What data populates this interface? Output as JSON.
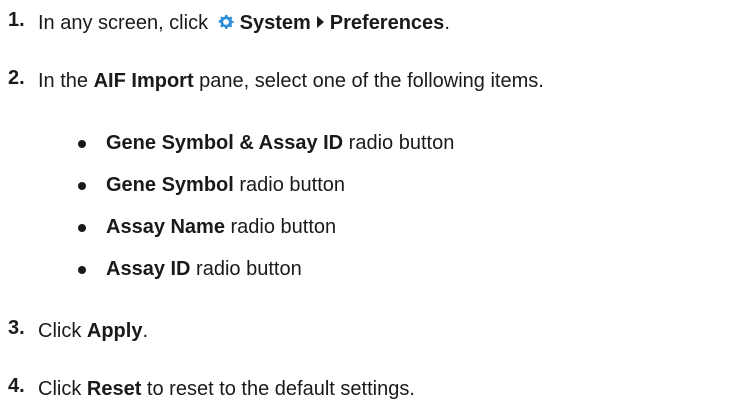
{
  "steps": [
    {
      "number": "1.",
      "prefix": "In any screen, click ",
      "icon": "gear-icon",
      "menu": "System",
      "submenu": "Preferences",
      "suffix": "."
    },
    {
      "number": "2.",
      "prefix": "In the ",
      "pane": "AIF Import",
      "suffix": " pane, select one of the following items."
    },
    {
      "number": "3.",
      "prefix": "Click ",
      "button": "Apply",
      "suffix": "."
    },
    {
      "number": "4.",
      "prefix": "Click ",
      "button": "Reset",
      "suffix": " to reset to the default settings."
    }
  ],
  "options": [
    {
      "label": "Gene Symbol & Assay ID",
      "suffix": " radio button"
    },
    {
      "label": "Gene Symbol",
      "suffix": " radio button"
    },
    {
      "label": "Assay Name",
      "suffix": " radio button"
    },
    {
      "label": "Assay ID",
      "suffix": " radio button"
    }
  ],
  "colors": {
    "icon": "#2f8fd8",
    "text": "#1a1a1a"
  }
}
